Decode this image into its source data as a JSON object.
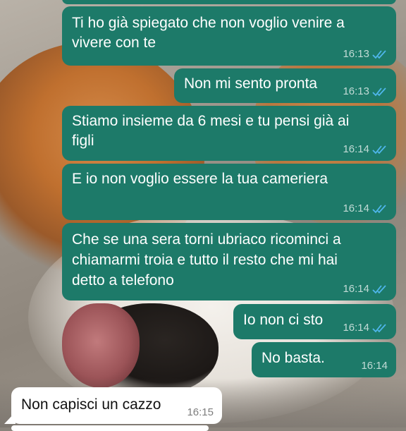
{
  "colors": {
    "outgoing_bubble": "#1d7a69",
    "incoming_bubble": "#ffffff",
    "read_check": "#4fb6ec"
  },
  "messages": [
    {
      "direction": "out",
      "text": "Ti ho già spiegato che non voglio venire a\nvivere con te",
      "time": "16:13",
      "status": "read"
    },
    {
      "direction": "out",
      "text": "Non mi sento pronta",
      "time": "16:13",
      "status": "read"
    },
    {
      "direction": "out",
      "text": "Stiamo insieme da 6 mesi e tu pensi già ai\nfigli",
      "time": "16:14",
      "status": "read"
    },
    {
      "direction": "out",
      "text": "E io non voglio essere la tua cameriera",
      "time": "16:14",
      "status": "read"
    },
    {
      "direction": "out",
      "text": "Che se una sera torni ubriaco ricominci a\nchiamarmi troia e tutto il resto che mi hai\ndetto a telefono",
      "time": "16:14",
      "status": "read"
    },
    {
      "direction": "out",
      "text": "Io non ci sto",
      "time": "16:14",
      "status": "read"
    },
    {
      "direction": "out",
      "text": "No basta.",
      "time": "16:14",
      "status": "sent"
    },
    {
      "direction": "in",
      "text": "Non capisci un cazzo",
      "time": "16:15"
    }
  ]
}
